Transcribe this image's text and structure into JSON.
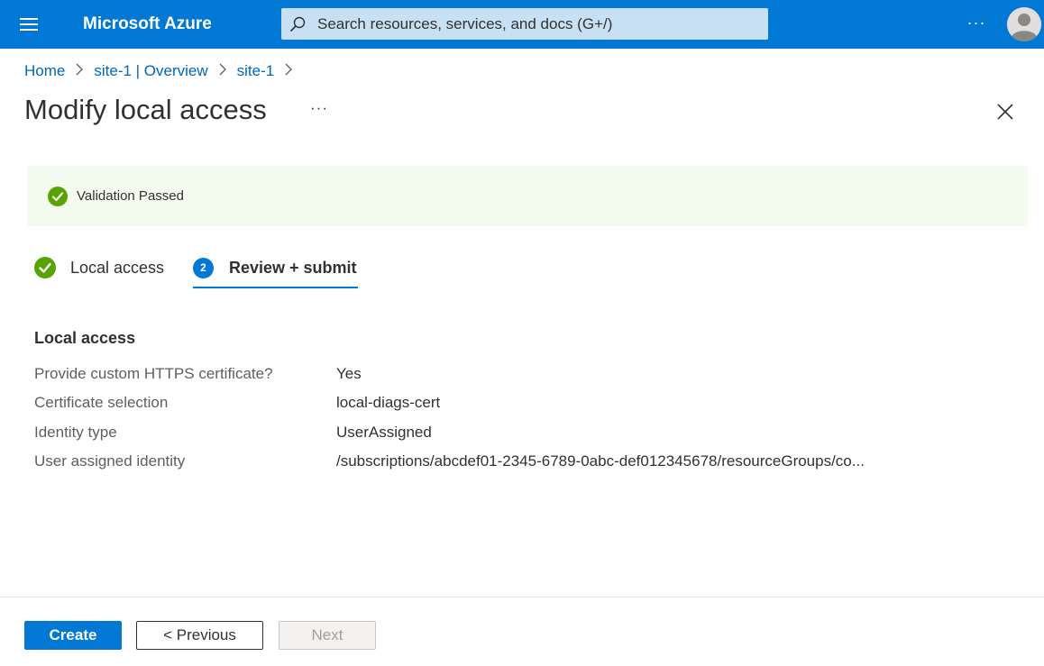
{
  "header": {
    "brand": "Microsoft Azure",
    "search_placeholder": "Search resources, services, and docs (G+/)",
    "more_label": "···"
  },
  "breadcrumb": {
    "items": [
      {
        "label": "Home"
      },
      {
        "label": "site-1 | Overview"
      },
      {
        "label": "site-1"
      }
    ],
    "separator": ">"
  },
  "page": {
    "title": "Modify local access",
    "more_label": "···"
  },
  "banner": {
    "text": "Validation Passed",
    "color": "#57a300"
  },
  "steps": [
    {
      "label": "Local access",
      "status": "completed"
    },
    {
      "number": "2",
      "label": "Review + submit",
      "status": "current"
    }
  ],
  "summary": {
    "heading": "Local access",
    "rows": [
      {
        "label": "Provide custom HTTPS certificate?",
        "value": "Yes"
      },
      {
        "label": "Certificate selection",
        "value": "local-diags-cert"
      },
      {
        "label": "Identity type",
        "value": "UserAssigned"
      },
      {
        "label": "User assigned identity",
        "value": "/subscriptions/abcdef01-2345-6789-0abc-def012345678/resourceGroups/co..."
      }
    ]
  },
  "footer": {
    "create_label": "Create",
    "previous_label": "< Previous",
    "next_label": "Next"
  },
  "colors": {
    "accent": "#0078d4",
    "success": "#57a300",
    "banner_bg": "#f3fbef"
  }
}
